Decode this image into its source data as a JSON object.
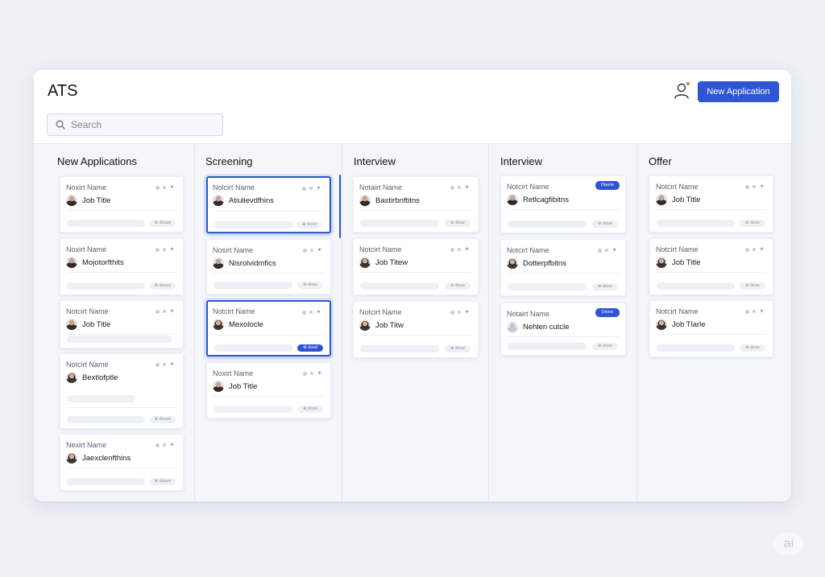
{
  "app": {
    "title": "ATS"
  },
  "search": {
    "placeholder": "Search"
  },
  "header": {
    "new_application_label": "New Application"
  },
  "watermark": "ai",
  "colors": {
    "accent": "#2f55d4",
    "notification": "#e07b3f",
    "background": "#eef1f6"
  },
  "icons": {
    "search": "search-icon",
    "user": "user-icon",
    "more": "dots-icon",
    "ai": "sparkle-icon"
  },
  "columns": [
    {
      "title": "New Applications",
      "cards": [
        {
          "name": "Noxirt Name",
          "job": "Job Title",
          "chip": "⊕ dosse"
        },
        {
          "name": "Noxirt Name",
          "job": "Mojotorfthits",
          "chip": "⊕ dosse"
        },
        {
          "name": "Notcirt Name",
          "job": "Job Title",
          "chip": ""
        },
        {
          "name": "Notcirt Name",
          "job": "Bextlofptle",
          "chip": "⊕ dosse"
        },
        {
          "name": "Nexirt Name",
          "job": "Jaexclenfthins",
          "chip": "⊕ dosse"
        }
      ]
    },
    {
      "title": "Screening",
      "cards": [
        {
          "name": "Nolcirt Name",
          "job": "Atiulievdfhins",
          "chip": "⊕ doso",
          "selected": true
        },
        {
          "name": "Nosirt Name",
          "job": "Nisrolvidmfics",
          "chip": "⊕ dose"
        },
        {
          "name": "Notcirt Name",
          "job": "Mexolocle",
          "chip": "⊕ dosd",
          "selected": true
        },
        {
          "name": "Noxirt Name",
          "job": "Job Title",
          "chip": "⊕ dose"
        }
      ]
    },
    {
      "title": "Interview",
      "cards": [
        {
          "name": "Notairt Name",
          "job": "Bastirbnftitns",
          "chip": "⊕ dose"
        },
        {
          "name": "Notcirt Name",
          "job": "Job Titew",
          "chip": "⊕ dose"
        },
        {
          "name": "Notcirt Name",
          "job": "Job Titw",
          "chip": "⊕ dose"
        }
      ]
    },
    {
      "title": "Interview",
      "cards": [
        {
          "name": "Notcirt Name",
          "job": "Retlcagfibitns",
          "chip": "⊕ dose",
          "tag": "Dtame"
        },
        {
          "name": "Notcirt Name",
          "job": "Dotterpfbitns",
          "chip": "⊕ dose"
        },
        {
          "name": "Notairt Name",
          "job": "Nehlen cutcle",
          "chip": "⊕ dose",
          "tag": "Dsme"
        }
      ]
    },
    {
      "title": "Offer",
      "cards": [
        {
          "name": "Notcirt Name",
          "job": "Job Title",
          "chip": "⊕ dose"
        },
        {
          "name": "Notcirt Name",
          "job": "Job Title",
          "chip": "⊕ dose"
        },
        {
          "name": "Notcirt Name",
          "job": "Job Tlarle",
          "chip": "⊕ dose"
        }
      ]
    }
  ]
}
